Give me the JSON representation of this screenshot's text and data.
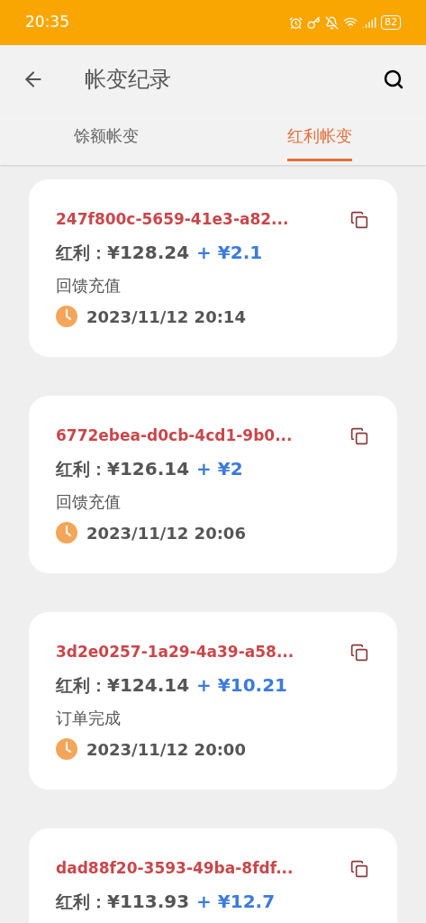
{
  "status_bar": {
    "time": "20:35",
    "battery": "82"
  },
  "header": {
    "title": "帐变纪录"
  },
  "tabs": [
    {
      "label": "馀额帐变",
      "selected": false
    },
    {
      "label": "红利帐变",
      "selected": true
    }
  ],
  "records": [
    {
      "id": "247f800c-5659-41e3-a82...",
      "label": "红利：",
      "balance": "¥128.24",
      "change": "+ ¥2.1",
      "reason": "回馈充值",
      "time": "2023/11/12 20:14"
    },
    {
      "id": "6772ebea-d0cb-4cd1-9b0...",
      "label": "红利：",
      "balance": "¥126.14",
      "change": "+ ¥2",
      "reason": "回馈充值",
      "time": "2023/11/12 20:06"
    },
    {
      "id": "3d2e0257-1a29-4a39-a58...",
      "label": "红利：",
      "balance": "¥124.14",
      "change": "+ ¥10.21",
      "reason": "订单完成",
      "time": "2023/11/12 20:00"
    },
    {
      "id": "dad88f20-3593-49ba-8fdf...",
      "label": "红利：",
      "balance": "¥113.93",
      "change": "+ ¥12.7"
    }
  ]
}
